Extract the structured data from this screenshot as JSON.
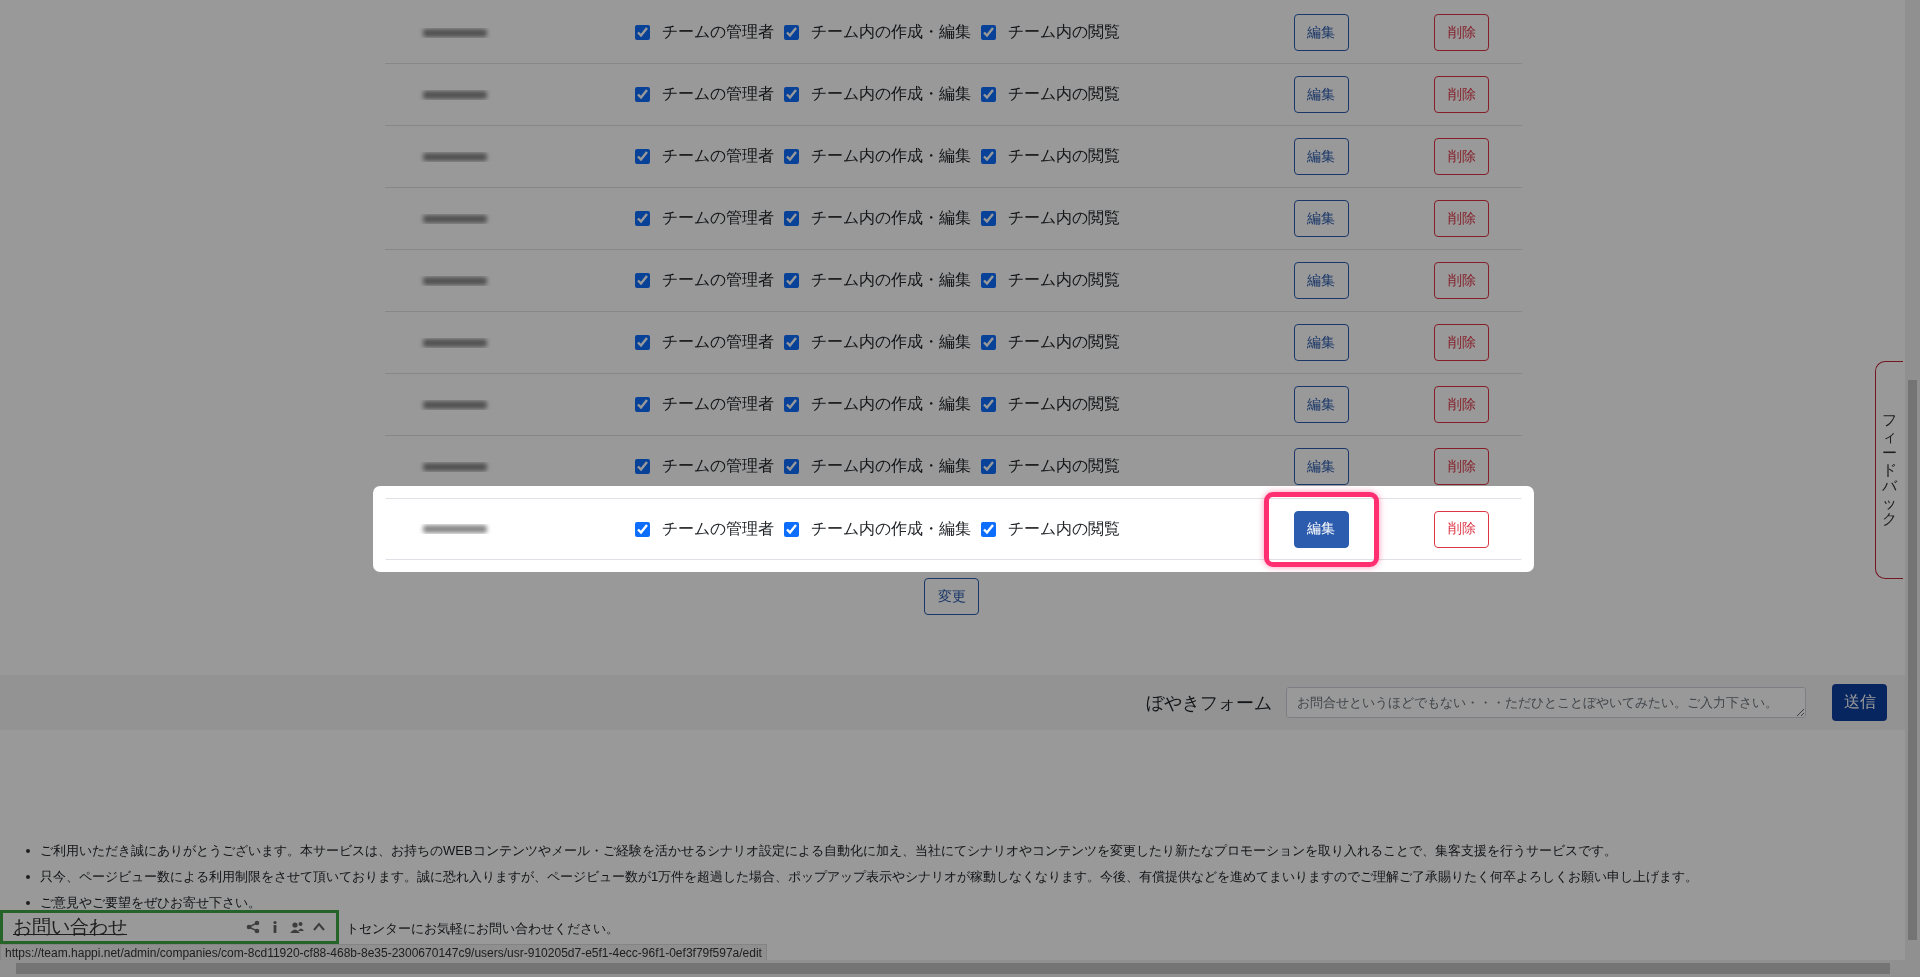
{
  "members": [
    {
      "permissions": [
        {
          "label": "チームの管理者",
          "checked": true
        },
        {
          "label": "チーム内の作成・編集",
          "checked": true
        },
        {
          "label": "チーム内の閲覧",
          "checked": true
        }
      ],
      "edit_button": "編集",
      "delete_button": "削除",
      "highlighted": false
    },
    {
      "permissions": [
        {
          "label": "チームの管理者",
          "checked": true
        },
        {
          "label": "チーム内の作成・編集",
          "checked": true
        },
        {
          "label": "チーム内の閲覧",
          "checked": true
        }
      ],
      "edit_button": "編集",
      "delete_button": "削除",
      "highlighted": false
    },
    {
      "permissions": [
        {
          "label": "チームの管理者",
          "checked": true
        },
        {
          "label": "チーム内の作成・編集",
          "checked": true
        },
        {
          "label": "チーム内の閲覧",
          "checked": true
        }
      ],
      "edit_button": "編集",
      "delete_button": "削除",
      "highlighted": false
    },
    {
      "permissions": [
        {
          "label": "チームの管理者",
          "checked": true
        },
        {
          "label": "チーム内の作成・編集",
          "checked": true
        },
        {
          "label": "チーム内の閲覧",
          "checked": true
        }
      ],
      "edit_button": "編集",
      "delete_button": "削除",
      "highlighted": false
    },
    {
      "permissions": [
        {
          "label": "チームの管理者",
          "checked": true
        },
        {
          "label": "チーム内の作成・編集",
          "checked": true
        },
        {
          "label": "チーム内の閲覧",
          "checked": true
        }
      ],
      "edit_button": "編集",
      "delete_button": "削除",
      "highlighted": false
    },
    {
      "permissions": [
        {
          "label": "チームの管理者",
          "checked": true
        },
        {
          "label": "チーム内の作成・編集",
          "checked": true
        },
        {
          "label": "チーム内の閲覧",
          "checked": true
        }
      ],
      "edit_button": "編集",
      "delete_button": "削除",
      "highlighted": false
    },
    {
      "permissions": [
        {
          "label": "チームの管理者",
          "checked": true
        },
        {
          "label": "チーム内の作成・編集",
          "checked": true
        },
        {
          "label": "チーム内の閲覧",
          "checked": true
        }
      ],
      "edit_button": "編集",
      "delete_button": "削除",
      "highlighted": false
    },
    {
      "permissions": [
        {
          "label": "チームの管理者",
          "checked": true
        },
        {
          "label": "チーム内の作成・編集",
          "checked": true
        },
        {
          "label": "チーム内の閲覧",
          "checked": true
        }
      ],
      "edit_button": "編集",
      "delete_button": "削除",
      "highlighted": false
    },
    {
      "permissions": [
        {
          "label": "チームの管理者",
          "checked": true
        },
        {
          "label": "チーム内の作成・編集",
          "checked": true
        },
        {
          "label": "チーム内の閲覧",
          "checked": true
        }
      ],
      "edit_button": "編集",
      "delete_button": "削除",
      "highlighted": true
    }
  ],
  "change_button": "変更",
  "feedback_tab": "フィードバック",
  "grumble_form": {
    "label": "ぼやきフォーム",
    "placeholder": "お問合せというほどでもない・・・ただひとことぼやいてみたい。ご入力下さい。",
    "submit": "送信"
  },
  "notices": [
    "ご利用いただき誠にありがとうございます。本サービスは、お持ちのWEBコンテンツやメール・ご経験を活かせるシナリオ設定による自動化に加え、当社にてシナリオやコンテンツを変更したり新たなプロモーションを取り入れることで、集客支援を行うサービスです。",
    "只今、ページビュー数による利用制限をさせて頂いております。誠に恐れ入りますが、ページビュー数が1万件を超過した場合、ポップアップ表示やシナリオが稼動しなくなります。今後、有償提供などを進めてまいりますのでご理解ご了承賜りたく何卒よろしくお願い申し上げます。",
    "ご意見やご要望をぜひお寄せ下さい。",
    "トセンターにお気軽にお問い合わせください。"
  ],
  "contact_widget": {
    "title": "お問い合わせ"
  },
  "status_url": "https://team.happi.net/admin/companies/com-8cd11920-cf88-468b-8e35-2300670147c9/users/usr-910205d7-e5f1-4ecc-96f1-0ef3f79f597a/edit"
}
